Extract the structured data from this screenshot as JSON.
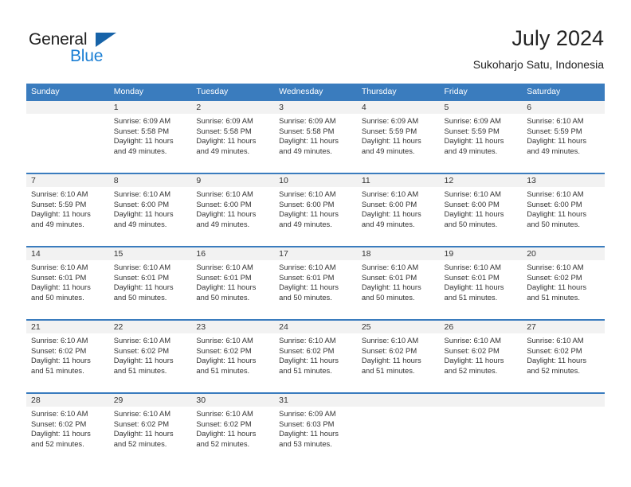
{
  "brand": {
    "name_part1": "General",
    "name_part2": "Blue",
    "triangle_icon": "triangle-icon",
    "color_dark": "#222222",
    "color_blue": "#1b7fd4",
    "color_triangle": "#1763a8"
  },
  "header": {
    "title": "July 2024",
    "subtitle": "Sukoharjo Satu, Indonesia"
  },
  "theme": {
    "header_blue": "#3a7cbe",
    "date_band_gray": "#f2f2f2",
    "text": "#333333"
  },
  "calendar": {
    "weekday_headers": [
      "Sunday",
      "Monday",
      "Tuesday",
      "Wednesday",
      "Thursday",
      "Friday",
      "Saturday"
    ],
    "labels": {
      "sunrise": "Sunrise:",
      "sunset": "Sunset:",
      "daylight": "Daylight:"
    },
    "weeks": [
      [
        {
          "day": "",
          "empty": true
        },
        {
          "day": "1",
          "sunrise": "Sunrise: 6:09 AM",
          "sunset": "Sunset: 5:58 PM",
          "daylight1": "Daylight: 11 hours",
          "daylight2": "and 49 minutes."
        },
        {
          "day": "2",
          "sunrise": "Sunrise: 6:09 AM",
          "sunset": "Sunset: 5:58 PM",
          "daylight1": "Daylight: 11 hours",
          "daylight2": "and 49 minutes."
        },
        {
          "day": "3",
          "sunrise": "Sunrise: 6:09 AM",
          "sunset": "Sunset: 5:58 PM",
          "daylight1": "Daylight: 11 hours",
          "daylight2": "and 49 minutes."
        },
        {
          "day": "4",
          "sunrise": "Sunrise: 6:09 AM",
          "sunset": "Sunset: 5:59 PM",
          "daylight1": "Daylight: 11 hours",
          "daylight2": "and 49 minutes."
        },
        {
          "day": "5",
          "sunrise": "Sunrise: 6:09 AM",
          "sunset": "Sunset: 5:59 PM",
          "daylight1": "Daylight: 11 hours",
          "daylight2": "and 49 minutes."
        },
        {
          "day": "6",
          "sunrise": "Sunrise: 6:10 AM",
          "sunset": "Sunset: 5:59 PM",
          "daylight1": "Daylight: 11 hours",
          "daylight2": "and 49 minutes."
        }
      ],
      [
        {
          "day": "7",
          "sunrise": "Sunrise: 6:10 AM",
          "sunset": "Sunset: 5:59 PM",
          "daylight1": "Daylight: 11 hours",
          "daylight2": "and 49 minutes."
        },
        {
          "day": "8",
          "sunrise": "Sunrise: 6:10 AM",
          "sunset": "Sunset: 6:00 PM",
          "daylight1": "Daylight: 11 hours",
          "daylight2": "and 49 minutes."
        },
        {
          "day": "9",
          "sunrise": "Sunrise: 6:10 AM",
          "sunset": "Sunset: 6:00 PM",
          "daylight1": "Daylight: 11 hours",
          "daylight2": "and 49 minutes."
        },
        {
          "day": "10",
          "sunrise": "Sunrise: 6:10 AM",
          "sunset": "Sunset: 6:00 PM",
          "daylight1": "Daylight: 11 hours",
          "daylight2": "and 49 minutes."
        },
        {
          "day": "11",
          "sunrise": "Sunrise: 6:10 AM",
          "sunset": "Sunset: 6:00 PM",
          "daylight1": "Daylight: 11 hours",
          "daylight2": "and 49 minutes."
        },
        {
          "day": "12",
          "sunrise": "Sunrise: 6:10 AM",
          "sunset": "Sunset: 6:00 PM",
          "daylight1": "Daylight: 11 hours",
          "daylight2": "and 50 minutes."
        },
        {
          "day": "13",
          "sunrise": "Sunrise: 6:10 AM",
          "sunset": "Sunset: 6:00 PM",
          "daylight1": "Daylight: 11 hours",
          "daylight2": "and 50 minutes."
        }
      ],
      [
        {
          "day": "14",
          "sunrise": "Sunrise: 6:10 AM",
          "sunset": "Sunset: 6:01 PM",
          "daylight1": "Daylight: 11 hours",
          "daylight2": "and 50 minutes."
        },
        {
          "day": "15",
          "sunrise": "Sunrise: 6:10 AM",
          "sunset": "Sunset: 6:01 PM",
          "daylight1": "Daylight: 11 hours",
          "daylight2": "and 50 minutes."
        },
        {
          "day": "16",
          "sunrise": "Sunrise: 6:10 AM",
          "sunset": "Sunset: 6:01 PM",
          "daylight1": "Daylight: 11 hours",
          "daylight2": "and 50 minutes."
        },
        {
          "day": "17",
          "sunrise": "Sunrise: 6:10 AM",
          "sunset": "Sunset: 6:01 PM",
          "daylight1": "Daylight: 11 hours",
          "daylight2": "and 50 minutes."
        },
        {
          "day": "18",
          "sunrise": "Sunrise: 6:10 AM",
          "sunset": "Sunset: 6:01 PM",
          "daylight1": "Daylight: 11 hours",
          "daylight2": "and 50 minutes."
        },
        {
          "day": "19",
          "sunrise": "Sunrise: 6:10 AM",
          "sunset": "Sunset: 6:01 PM",
          "daylight1": "Daylight: 11 hours",
          "daylight2": "and 51 minutes."
        },
        {
          "day": "20",
          "sunrise": "Sunrise: 6:10 AM",
          "sunset": "Sunset: 6:02 PM",
          "daylight1": "Daylight: 11 hours",
          "daylight2": "and 51 minutes."
        }
      ],
      [
        {
          "day": "21",
          "sunrise": "Sunrise: 6:10 AM",
          "sunset": "Sunset: 6:02 PM",
          "daylight1": "Daylight: 11 hours",
          "daylight2": "and 51 minutes."
        },
        {
          "day": "22",
          "sunrise": "Sunrise: 6:10 AM",
          "sunset": "Sunset: 6:02 PM",
          "daylight1": "Daylight: 11 hours",
          "daylight2": "and 51 minutes."
        },
        {
          "day": "23",
          "sunrise": "Sunrise: 6:10 AM",
          "sunset": "Sunset: 6:02 PM",
          "daylight1": "Daylight: 11 hours",
          "daylight2": "and 51 minutes."
        },
        {
          "day": "24",
          "sunrise": "Sunrise: 6:10 AM",
          "sunset": "Sunset: 6:02 PM",
          "daylight1": "Daylight: 11 hours",
          "daylight2": "and 51 minutes."
        },
        {
          "day": "25",
          "sunrise": "Sunrise: 6:10 AM",
          "sunset": "Sunset: 6:02 PM",
          "daylight1": "Daylight: 11 hours",
          "daylight2": "and 51 minutes."
        },
        {
          "day": "26",
          "sunrise": "Sunrise: 6:10 AM",
          "sunset": "Sunset: 6:02 PM",
          "daylight1": "Daylight: 11 hours",
          "daylight2": "and 52 minutes."
        },
        {
          "day": "27",
          "sunrise": "Sunrise: 6:10 AM",
          "sunset": "Sunset: 6:02 PM",
          "daylight1": "Daylight: 11 hours",
          "daylight2": "and 52 minutes."
        }
      ],
      [
        {
          "day": "28",
          "sunrise": "Sunrise: 6:10 AM",
          "sunset": "Sunset: 6:02 PM",
          "daylight1": "Daylight: 11 hours",
          "daylight2": "and 52 minutes."
        },
        {
          "day": "29",
          "sunrise": "Sunrise: 6:10 AM",
          "sunset": "Sunset: 6:02 PM",
          "daylight1": "Daylight: 11 hours",
          "daylight2": "and 52 minutes."
        },
        {
          "day": "30",
          "sunrise": "Sunrise: 6:10 AM",
          "sunset": "Sunset: 6:02 PM",
          "daylight1": "Daylight: 11 hours",
          "daylight2": "and 52 minutes."
        },
        {
          "day": "31",
          "sunrise": "Sunrise: 6:09 AM",
          "sunset": "Sunset: 6:03 PM",
          "daylight1": "Daylight: 11 hours",
          "daylight2": "and 53 minutes."
        },
        {
          "day": "",
          "empty": true
        },
        {
          "day": "",
          "empty": true
        },
        {
          "day": "",
          "empty": true
        }
      ]
    ]
  }
}
